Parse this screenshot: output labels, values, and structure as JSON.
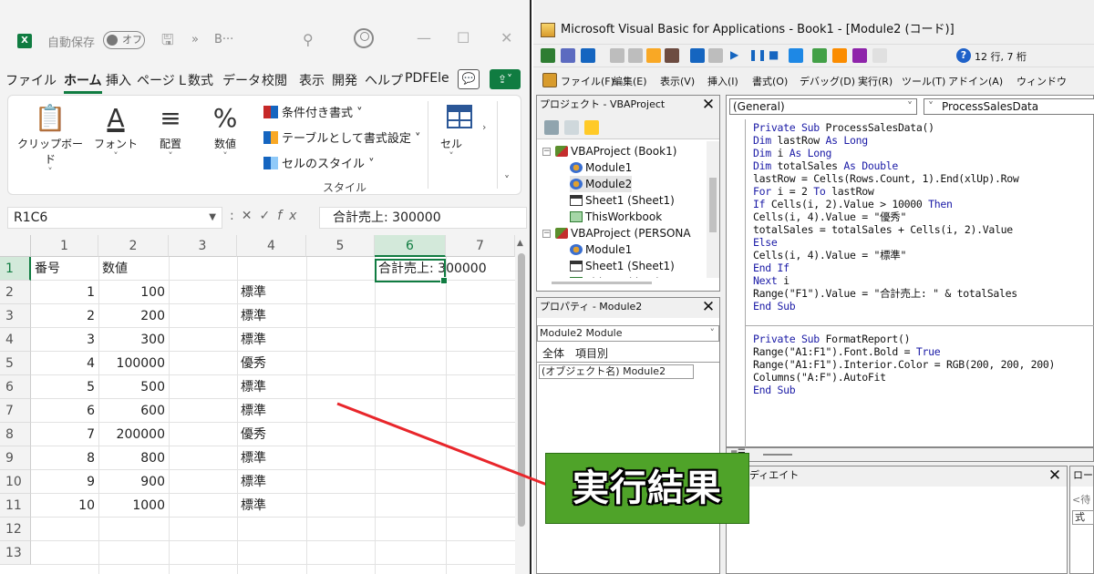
{
  "excel": {
    "logo": "X",
    "autosave_label": "自動保存",
    "autosave_state": "オフ",
    "titlebar_dots": "»",
    "titlebar_book": "B···",
    "tabs": [
      "ファイル",
      "ホーム",
      "挿入",
      "ページ L",
      "数式",
      "データ",
      "校閲",
      "表示",
      "開発",
      "ヘルプ",
      "PDFEle"
    ],
    "active_tab": "ホーム",
    "ribbon": {
      "clipboard": "クリップボード",
      "font": "フォント",
      "align": "配置",
      "number": "数値",
      "cond_format": "条件付き書式 ˅",
      "table_format": "テーブルとして書式設定 ˅",
      "cell_style": "セルのスタイル ˅",
      "style_group": "スタイル",
      "cells": "セル"
    },
    "name_box": "R1C6",
    "formula_value": "合計売上: 300000",
    "columns": [
      "1",
      "2",
      "3",
      "4",
      "5",
      "6",
      "7"
    ],
    "rows": [
      "1",
      "2",
      "3",
      "4",
      "5",
      "6",
      "7",
      "8",
      "9",
      "10",
      "11",
      "12",
      "13"
    ],
    "header": {
      "c1": "番号",
      "c2": "数値",
      "c6": "合計売上: 300000"
    },
    "data_rows": [
      {
        "no": "1",
        "value": "100",
        "grade": "標準"
      },
      {
        "no": "2",
        "value": "200",
        "grade": "標準"
      },
      {
        "no": "3",
        "value": "300",
        "grade": "標準"
      },
      {
        "no": "4",
        "value": "100000",
        "grade": "優秀"
      },
      {
        "no": "5",
        "value": "500",
        "grade": "標準"
      },
      {
        "no": "6",
        "value": "600",
        "grade": "標準"
      },
      {
        "no": "7",
        "value": "200000",
        "grade": "優秀"
      },
      {
        "no": "8",
        "value": "800",
        "grade": "標準"
      },
      {
        "no": "9",
        "value": "900",
        "grade": "標準"
      },
      {
        "no": "10",
        "value": "1000",
        "grade": "標準"
      }
    ]
  },
  "vba": {
    "title": "Microsoft Visual Basic for Applications - Book1 - [Module2 (コード)]",
    "cursor_pos": "12 行, 7 桁",
    "menu": [
      "ファイル(F)",
      "編集(E)",
      "表示(V)",
      "挿入(I)",
      "書式(O)",
      "デバッグ(D)",
      "実行(R)",
      "ツール(T)",
      "アドイン(A)",
      "ウィンドウ"
    ],
    "project_title": "プロジェクト - VBAProject",
    "tree": [
      {
        "label": "VBAProject (Book1)",
        "level": "0",
        "icon": "project"
      },
      {
        "label": "Module1",
        "level": "1",
        "icon": "module"
      },
      {
        "label": "Module2",
        "level": "1",
        "icon": "module"
      },
      {
        "label": "Sheet1 (Sheet1)",
        "level": "1",
        "icon": "sheet"
      },
      {
        "label": "ThisWorkbook",
        "level": "1",
        "icon": "workbook"
      },
      {
        "label": "VBAProject (PERSONA",
        "level": "0",
        "icon": "project"
      },
      {
        "label": "Module1",
        "level": "1",
        "icon": "module"
      },
      {
        "label": "Sheet1 (Sheet1)",
        "level": "1",
        "icon": "sheet"
      },
      {
        "label": "ThisWorkbook",
        "level": "1",
        "icon": "workbook"
      }
    ],
    "properties_title": "プロパティ - Module2",
    "properties_combo": "Module2 Module",
    "properties_tabs": [
      "全体",
      "項目別"
    ],
    "properties_row": "(オブジェクト名) Module2",
    "code_combo_left": "(General)",
    "code_combo_right": "ProcessSalesData",
    "code_lines": [
      "Private Sub ProcessSalesData()",
      "Dim lastRow As Long",
      "Dim i As Long",
      "Dim totalSales As Double",
      "lastRow = Cells(Rows.Count, 1).End(xlUp).Row",
      "For i = 2 To lastRow",
      "If Cells(i, 2).Value > 10000 Then",
      "Cells(i, 4).Value = \"優秀\"",
      "totalSales = totalSales + Cells(i, 2).Value",
      "Else",
      "Cells(i, 4).Value = \"標準\"",
      "End If",
      "Next i",
      "Range(\"F1\").Value = \"合計売上: \" & totalSales",
      "End Sub",
      "",
      "Private Sub FormatReport()",
      "Range(\"A1:F1\").Font.Bold = True",
      "Range(\"A1:F1\").Interior.Color = RGB(200, 200, 200)",
      "Columns(\"A:F\").AutoFit",
      "End Sub"
    ],
    "immediate_title": "イミディエイト",
    "locals_title": "ローカル",
    "locals_status": "<待",
    "locals_header": "式"
  },
  "callout": "実行結果",
  "colors": {
    "excel_green": "#107c41",
    "callout_green": "#4fa329",
    "arrow_red": "#e8262b",
    "code_keyword": "#1a1aa6"
  }
}
